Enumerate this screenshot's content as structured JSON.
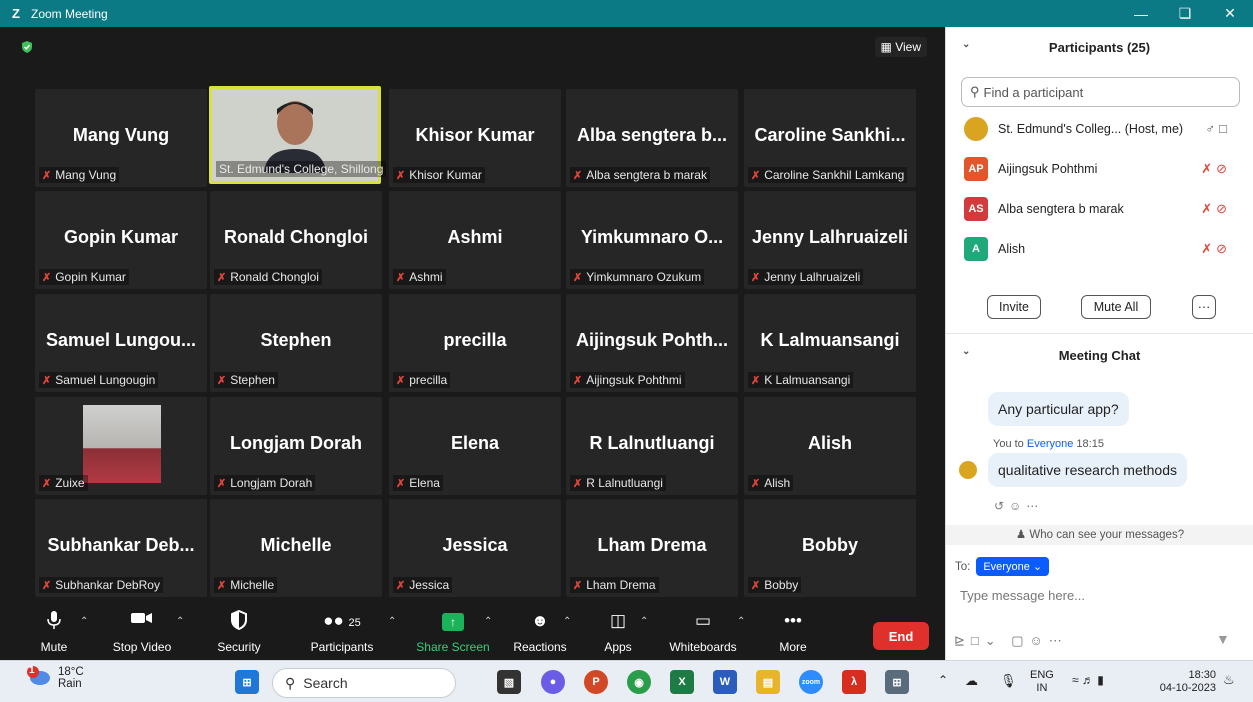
{
  "window": {
    "title": "Zoom Meeting",
    "logo": "Z"
  },
  "view_button": "View",
  "tiles": [
    {
      "big": "Mang Vung",
      "small": "Mang Vung"
    },
    {
      "big": "",
      "small": "St. Edmund's College, Shillong",
      "video": true
    },
    {
      "big": "Khisor Kumar",
      "small": "Khisor Kumar"
    },
    {
      "big": "Alba sengtera b...",
      "small": "Alba sengtera b marak"
    },
    {
      "big": "Caroline Sankhi...",
      "small": "Caroline Sankhil Lamkang"
    },
    {
      "big": "Gopin Kumar",
      "small": "Gopin Kumar"
    },
    {
      "big": "Ronald Chongloi",
      "small": "Ronald Chongloi"
    },
    {
      "big": "Ashmi",
      "small": "Ashmi"
    },
    {
      "big": "Yimkumnaro O...",
      "small": "Yimkumnaro Ozukum"
    },
    {
      "big": "Jenny Lalhruaizeli",
      "small": "Jenny Lalhruaizeli"
    },
    {
      "big": "Samuel Lungou...",
      "small": "Samuel Lungougin"
    },
    {
      "big": "Stephen",
      "small": "Stephen"
    },
    {
      "big": "precilla",
      "small": "precilla"
    },
    {
      "big": "Aijingsuk Pohth...",
      "small": "Aijingsuk Pohthmi"
    },
    {
      "big": "K Lalmuansangi",
      "small": "K Lalmuansangi"
    },
    {
      "big": "",
      "small": "Zuixe",
      "photo": true
    },
    {
      "big": "Longjam Dorah",
      "small": "Longjam Dorah"
    },
    {
      "big": "Elena",
      "small": "Elena"
    },
    {
      "big": "R Lalnutluangi",
      "small": "R Lalnutluangi"
    },
    {
      "big": "Alish",
      "small": "Alish"
    },
    {
      "big": "Subhankar Deb...",
      "small": "Subhankar DebRoy"
    },
    {
      "big": "Michelle",
      "small": "Michelle"
    },
    {
      "big": "Jessica",
      "small": "Jessica"
    },
    {
      "big": "Lham Drema",
      "small": "Lham Drema"
    },
    {
      "big": "Bobby",
      "small": "Bobby"
    }
  ],
  "toolbar": {
    "mute": "Mute",
    "stop_video": "Stop Video",
    "security": "Security",
    "participants": "Participants",
    "participants_count": "25",
    "share_screen": "Share Screen",
    "reactions": "Reactions",
    "apps": "Apps",
    "whiteboards": "Whiteboards",
    "more": "More",
    "end": "End"
  },
  "participants_panel": {
    "title": "Participants (25)",
    "search_placeholder": "Find a participant",
    "rows": [
      {
        "initials": "",
        "name": "St. Edmund's Colleg...  (Host, me)",
        "color": "#ffffff"
      },
      {
        "initials": "AP",
        "name": "Aijingsuk Pohthmi",
        "color": "#e2562b"
      },
      {
        "initials": "AS",
        "name": "Alba sengtera b marak",
        "color": "#d23b3b"
      },
      {
        "initials": "A",
        "name": "Alish",
        "color": "#1fa97a"
      }
    ],
    "invite": "Invite",
    "mute_all": "Mute All",
    "more": "···"
  },
  "chat_panel": {
    "title": "Meeting Chat",
    "msg1": "Any particular app?",
    "meta_prefix": "You to ",
    "meta_target": "Everyone",
    "meta_time": "18:15",
    "msg2": "qualitative research methods",
    "who_can_see": "Who can see your messages?",
    "to_label": "To:",
    "to_value": "Everyone",
    "placeholder": "Type message here..."
  },
  "taskbar": {
    "temp": "18°C",
    "weather": "Rain",
    "badge": "1",
    "search": "Search",
    "lang1": "ENG",
    "lang2": "IN",
    "time": "18:30",
    "date": "04-10-2023"
  },
  "colors": {
    "titlebar": "#0b7a84",
    "end": "#e0302b",
    "accent": "#0b5cff",
    "active_speaker": "#d8e23a"
  }
}
